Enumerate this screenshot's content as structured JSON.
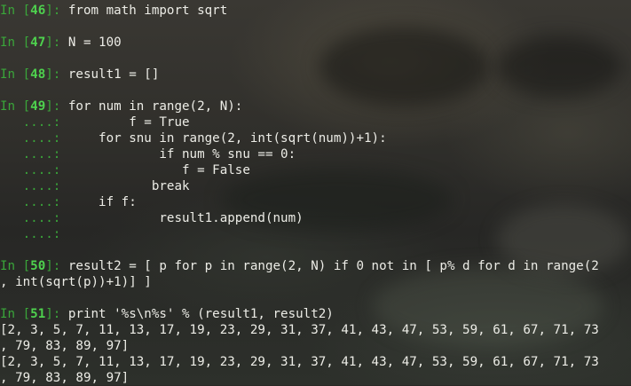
{
  "colors": {
    "prompt": "#3aa63a",
    "prompt_number": "#4ed14e",
    "text": "#ecece6"
  },
  "cells": [
    {
      "num": "46",
      "lines": [
        "from math import sqrt"
      ],
      "output": []
    },
    {
      "num": "47",
      "lines": [
        "N = 100"
      ],
      "output": []
    },
    {
      "num": "48",
      "lines": [
        "result1 = []"
      ],
      "output": []
    },
    {
      "num": "49",
      "lines": [
        "for num in range(2, N):",
        "        f = True",
        "    for snu in range(2, int(sqrt(num))+1):",
        "            if num % snu == 0:",
        "               f = False",
        "           break",
        "    if f:",
        "            result1.append(num)",
        ""
      ],
      "output": []
    },
    {
      "num": "50",
      "lines": [
        "result2 = [ p for p in range(2, N) if 0 not in [ p% d for d in range(2"
      ],
      "wrap": [
        ", int(sqrt(p))+1)] ]"
      ],
      "output": []
    },
    {
      "num": "51",
      "lines": [
        "print '%s\\n%s' % (result1, result2)"
      ],
      "output": [
        "[2, 3, 5, 7, 11, 13, 17, 19, 23, 29, 31, 37, 41, 43, 47, 53, 59, 61, 67, 71, 73",
        ", 79, 83, 89, 97]",
        "[2, 3, 5, 7, 11, 13, 17, 19, 23, 29, 31, 37, 41, 43, 47, 53, 59, 61, 67, 71, 73",
        ", 79, 83, 89, 97]"
      ]
    }
  ],
  "prompt": {
    "in": "In [",
    "close": "]: ",
    "cont": "   ....: "
  }
}
